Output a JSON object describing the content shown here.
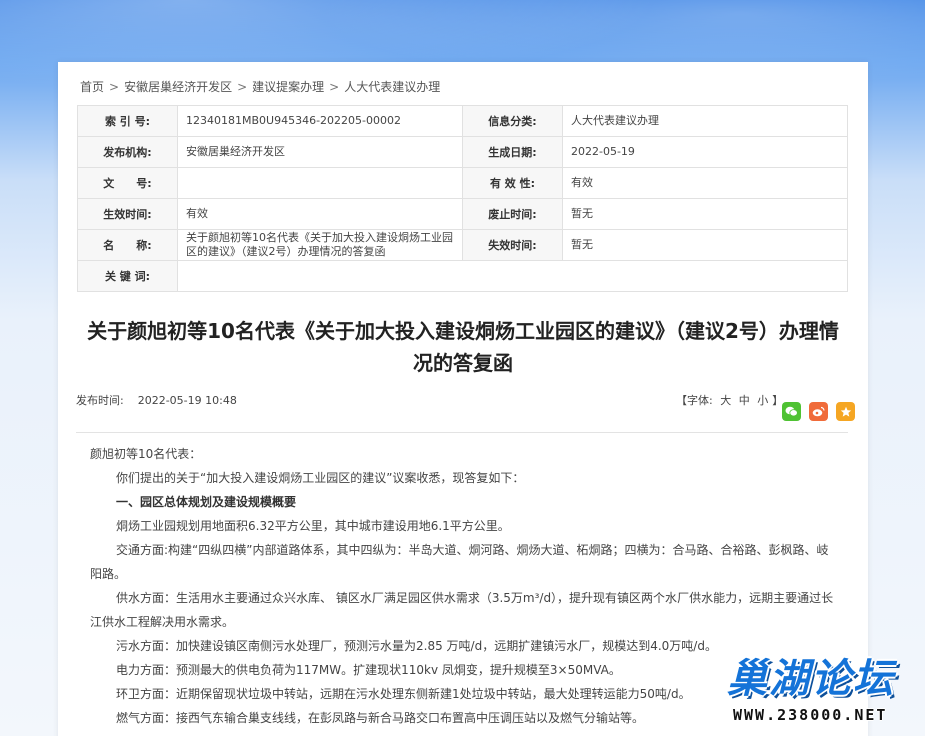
{
  "breadcrumb": [
    "首页",
    "安徽居巢经济开发区",
    "建议提案办理",
    "人大代表建议办理"
  ],
  "breadcrumb_sep": ">",
  "meta": [
    [
      {
        "label": "索 引 号:",
        "value": "12340181MB0U945346-202205-00002"
      },
      {
        "label": "信息分类:",
        "value": "人大代表建议办理"
      }
    ],
    [
      {
        "label": "发布机构:",
        "value": "安徽居巢经济开发区"
      },
      {
        "label": "生成日期:",
        "value": "2022-05-19"
      }
    ],
    [
      {
        "label": "文　　号:",
        "value": ""
      },
      {
        "label": "有 效 性:",
        "value": "有效"
      }
    ],
    [
      {
        "label": "生效时间:",
        "value": "有效"
      },
      {
        "label": "废止时间:",
        "value": "暂无"
      }
    ],
    [
      {
        "label": "名　　称:",
        "value": "关于颜旭初等10名代表《关于加大投入建设烔炀工业园区的建议》（建议2号）办理情况的答复函"
      },
      {
        "label": "失效时间:",
        "value": "暂无"
      }
    ],
    [
      {
        "label": "关 键 词:",
        "value": ""
      }
    ]
  ],
  "title": "关于颜旭初等10名代表《关于加大投入建设烔炀工业园区的建议》（建议2号）办理情况的答复函",
  "publish": {
    "label": "发布时间:",
    "time": "2022-05-19 10:48"
  },
  "font_size": {
    "open": "【字体:",
    "large": "大",
    "medium": "中",
    "small": "小",
    "close": "】"
  },
  "share_icons": [
    "wechat-icon",
    "weibo-icon",
    "favorite-icon"
  ],
  "colors": {
    "wechat": "#4fc233",
    "weibo": "#f06b3a",
    "favorite": "#f5a623",
    "watermark": "#1473d8"
  },
  "content": [
    {
      "text": "颜旭初等10名代表：",
      "style": "plain"
    },
    {
      "text": "你们提出的关于“加大投入建设烔炀工业园区的建议”议案收悉，现答复如下：",
      "style": "ind"
    },
    {
      "text": "一、园区总体规划及建设规模概要",
      "style": "ind bold"
    },
    {
      "text": "烔炀工业园规划用地面积6.32平方公里，其中城市建设用地6.1平方公里。",
      "style": "ind"
    },
    {
      "text": "交通方面:构建“四纵四横”内部道路体系，其中四纵为：半岛大道、烔河路、烔炀大道、柘烔路；四横为：合马路、合裕路、彭枫路、岐阳路。",
      "style": "ind"
    },
    {
      "text": "供水方面：生活用水主要通过众兴水库、 镇区水厂满足园区供水需求（3.5万m³/d），提升现有镇区两个水厂供水能力，远期主要通过长江供水工程解决用水需求。",
      "style": "ind"
    },
    {
      "text": "污水方面：加快建设镇区南侧污水处理厂，预测污水量为2.85 万吨/d，远期扩建镇污水厂，规模达到4.0万吨/d。",
      "style": "ind"
    },
    {
      "text": "电力方面：预测最大的供电负荷为117MW。扩建现状110kv 凤烔变，提升规模至3×50MVA。",
      "style": "ind"
    },
    {
      "text": "环卫方面：近期保留现状垃圾中转站，远期在污水处理东侧新建1处垃圾中转站，最大处理转运能力50吨/d。",
      "style": "ind"
    },
    {
      "text": "燃气方面：接西气东输合巢支线线，在彭凤路与新合马路交口布置高中压调压站以及燃气分输站等。",
      "style": "ind"
    }
  ],
  "watermark": {
    "title": "巢湖论坛",
    "url": "WWW.238000.NET"
  }
}
